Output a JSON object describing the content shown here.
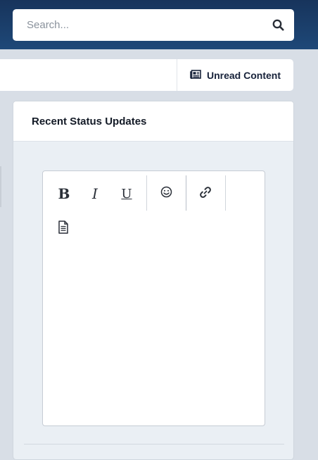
{
  "header": {
    "search": {
      "placeholder": "Search..."
    }
  },
  "nav": {
    "unread_label": "Unread Content"
  },
  "widget": {
    "title": "Recent Status Updates"
  },
  "editor": {
    "toolbar": {
      "bold": "B",
      "italic": "I",
      "underline": "U"
    }
  }
}
